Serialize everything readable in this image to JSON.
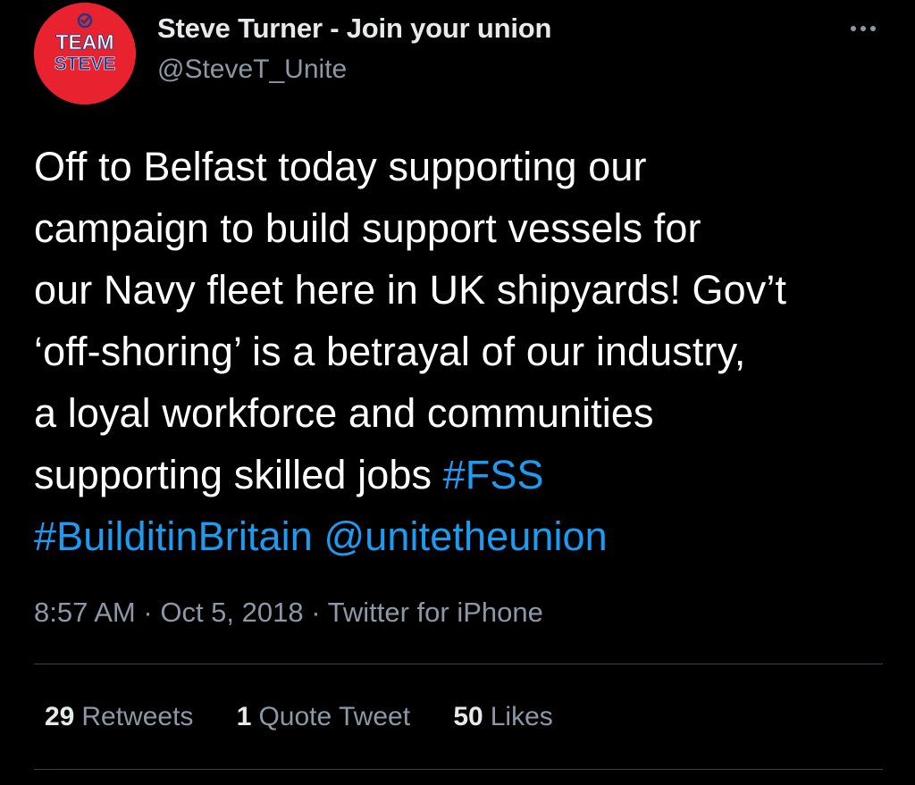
{
  "author": {
    "display_name": "Steve Turner - Join your union",
    "handle": "@SteveT_Unite",
    "avatar": {
      "line1": "TEAM",
      "line2": "STEVE",
      "background": "#e8232f",
      "icon": "checkmark-badge-icon"
    }
  },
  "tweet": {
    "lines": [
      "Off to Belfast today supporting our",
      "campaign to build support vessels for",
      "our Navy fleet here in UK shipyards! Gov’t",
      "‘off-shoring’ is a betrayal of our industry,",
      "a loyal workforce and communities",
      "supporting skilled jobs "
    ],
    "hashtag_fss": "#FSS",
    "hashtag_build": "#BuilditinBritain",
    "mention": "@unitetheunion"
  },
  "meta": {
    "time": "8:57 AM",
    "date": "Oct 5, 2018",
    "separator": "·",
    "source": "Twitter for iPhone"
  },
  "stats": {
    "retweets_count": "29",
    "retweets_label": "Retweets",
    "quotes_count": "1",
    "quotes_label": "Quote Tweet",
    "likes_count": "50",
    "likes_label": "Likes"
  },
  "colors": {
    "background": "#000000",
    "text": "#ffffff",
    "secondary": "#8b98a5",
    "link": "#1d9bf0",
    "divider": "#38444d"
  },
  "icons": {
    "more": "more-horizontal-icon"
  }
}
